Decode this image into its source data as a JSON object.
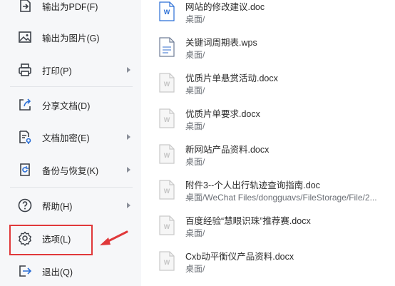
{
  "menu": {
    "items": [
      {
        "label": "输出为PDF(F)",
        "icon": "export-pdf-icon"
      },
      {
        "label": "输出为图片(G)",
        "icon": "export-image-icon"
      },
      {
        "label": "打印(P)",
        "icon": "printer-icon",
        "submenu": true
      },
      {
        "label": "分享文档(D)",
        "icon": "share-icon"
      },
      {
        "label": "文档加密(E)",
        "icon": "encrypt-icon",
        "submenu": true
      },
      {
        "label": "备份与恢复(K)",
        "icon": "backup-restore-icon",
        "submenu": true
      },
      {
        "label": "帮助(H)",
        "icon": "help-icon",
        "submenu": true
      },
      {
        "label": "选项(L)",
        "icon": "settings-gear-icon",
        "highlighted": true
      },
      {
        "label": "退出(Q)",
        "icon": "exit-icon"
      }
    ]
  },
  "files": [
    {
      "name": "网站的修改建议.doc",
      "path": "桌面/",
      "icon": "word-doc-icon"
    },
    {
      "name": "关键词周期表.wps",
      "path": "桌面/",
      "icon": "wps-doc-icon"
    },
    {
      "name": "优质片单悬赏活动.docx",
      "path": "桌面/",
      "icon": "word-doc-faded-icon"
    },
    {
      "name": "优质片单要求.docx",
      "path": "桌面/",
      "icon": "word-doc-faded-icon"
    },
    {
      "name": "新网站产品资料.docx",
      "path": "桌面/",
      "icon": "word-doc-faded-icon"
    },
    {
      "name": "附件3--个人出行轨迹查询指南.doc",
      "path": "桌面/WeChat Files/dongguavs/FileStorage/File/2...",
      "icon": "word-doc-faded-icon"
    },
    {
      "name": "百度经验“慧眼识珠”推荐赛.docx",
      "path": "桌面/",
      "icon": "word-doc-faded-icon"
    },
    {
      "name": "Cxb动平衡仪产品资料.docx",
      "path": "桌面/",
      "icon": "word-doc-faded-icon"
    }
  ],
  "colors": {
    "accent": "#2b6fd6",
    "highlight": "#e0383a",
    "icon": "#3a3f47"
  }
}
